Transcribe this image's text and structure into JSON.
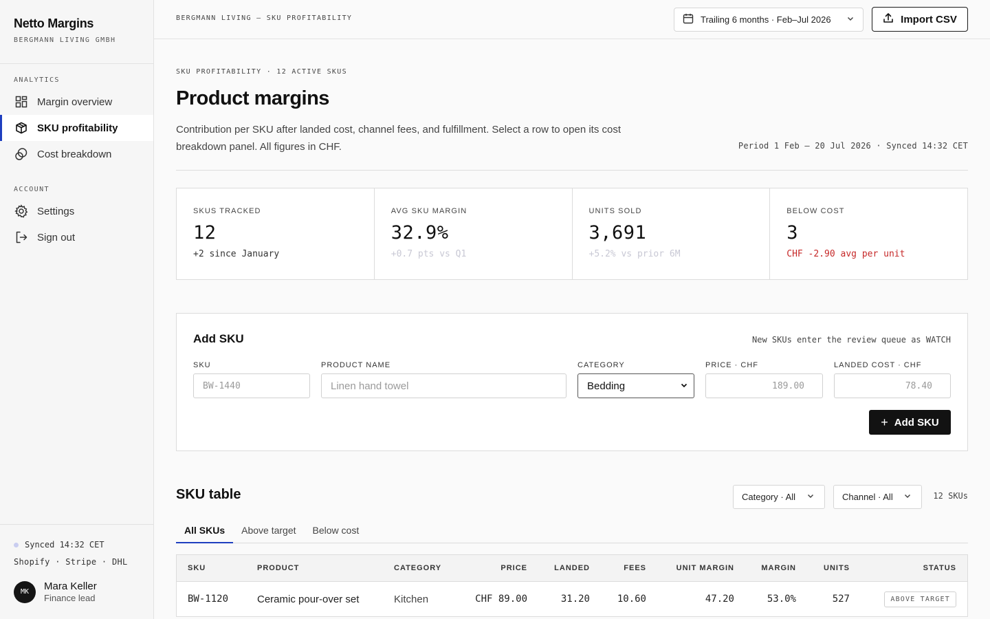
{
  "app": {
    "title": "Netto Margins",
    "company": "BERGMANN LIVING GMBH"
  },
  "sidebar": {
    "analytics_label": "ANALYTICS",
    "account_label": "ACCOUNT",
    "items": [
      {
        "label": "Margin overview",
        "icon": "grid-icon"
      },
      {
        "label": "SKU profitability",
        "icon": "box-icon",
        "active": true
      },
      {
        "label": "Cost breakdown",
        "icon": "coins-icon"
      },
      {
        "label": "Settings",
        "icon": "gear-icon"
      },
      {
        "label": "Sign out",
        "icon": "sign-out-icon"
      }
    ],
    "sync_status": "Synced 14:32 CET",
    "integrations": "Shopify · Stripe · DHL",
    "user": {
      "initials": "MK",
      "name": "Mara Keller",
      "role": "Finance lead"
    }
  },
  "topbar": {
    "breadcrumb": "BERGMANN LIVING — SKU PROFITABILITY",
    "period_label": "Trailing 6 months · Feb–Jul 2026",
    "import_label": "Import CSV"
  },
  "header": {
    "eyebrow": "SKU PROFITABILITY · 12 ACTIVE SKUS",
    "title": "Product margins",
    "description": "Contribution per SKU after landed cost, channel fees, and fulfillment. Select a row to open its cost breakdown panel. All figures in CHF.",
    "period_meta": "Period 1 Feb – 20 Jul 2026 · Synced 14:32 CET"
  },
  "kpis": [
    {
      "label": "SKUS TRACKED",
      "value": "12",
      "note": "+2 since January",
      "tone": "default"
    },
    {
      "label": "AVG SKU MARGIN",
      "value": "32.9%",
      "note": "+0.7 pts vs Q1",
      "tone": "muted"
    },
    {
      "label": "UNITS SOLD",
      "value": "3,691",
      "note": "+5.2% vs prior 6M",
      "tone": "muted"
    },
    {
      "label": "BELOW COST",
      "value": "3",
      "note": "CHF -2.90 avg per unit",
      "tone": "negative"
    }
  ],
  "add_sku": {
    "title": "Add SKU",
    "hint": "New SKUs enter the review queue as WATCH",
    "fields": {
      "sku": {
        "label": "SKU",
        "placeholder": "BW-1440"
      },
      "name": {
        "label": "PRODUCT NAME",
        "placeholder": "Linen hand towel"
      },
      "category": {
        "label": "CATEGORY",
        "value": "Bedding"
      },
      "price": {
        "label": "PRICE · CHF",
        "placeholder": "189.00"
      },
      "landed": {
        "label": "LANDED COST · CHF",
        "placeholder": "78.40"
      }
    },
    "submit_label": "Add SKU"
  },
  "sku_table": {
    "title": "SKU table",
    "filters": {
      "category": "Category · All",
      "channel": "Channel · All"
    },
    "count": "12 SKUs",
    "tabs": [
      {
        "label": "All SKUs",
        "active": true
      },
      {
        "label": "Above target"
      },
      {
        "label": "Below cost"
      }
    ],
    "columns": [
      "SKU",
      "PRODUCT",
      "CATEGORY",
      "PRICE",
      "LANDED",
      "FEES",
      "UNIT MARGIN",
      "MARGIN",
      "UNITS",
      "STATUS"
    ],
    "rows": [
      {
        "sku": "BW-1120",
        "product": "Ceramic pour-over set",
        "category": "Kitchen",
        "price": "CHF 89.00",
        "landed": "31.20",
        "fees": "10.60",
        "unit_margin": "47.20",
        "margin": "53.0%",
        "units": "527",
        "status": "ABOVE TARGET"
      }
    ]
  },
  "colors": {
    "accent": "#1f3fbf",
    "negative": "#c62828",
    "dark": "#121212"
  }
}
